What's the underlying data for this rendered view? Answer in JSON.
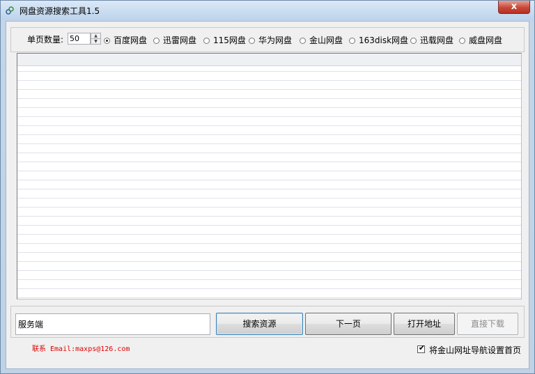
{
  "window": {
    "title": "网盘资源搜索工具1.5",
    "close_glyph": "x"
  },
  "options": {
    "page_count_label": "单页数量:",
    "page_count_value": "50",
    "providers": [
      {
        "label": "百度网盘",
        "selected": true
      },
      {
        "label": "迅雷网盘",
        "selected": false
      },
      {
        "label": "115网盘",
        "selected": false
      },
      {
        "label": "华为网盘",
        "selected": false
      },
      {
        "label": "金山网盘",
        "selected": false
      },
      {
        "label": "163disk网盘",
        "selected": false
      },
      {
        "label": "迅载网盘",
        "selected": false
      },
      {
        "label": "威盘网盘",
        "selected": false
      }
    ]
  },
  "bottom": {
    "server_input_value": "服务端",
    "search_button": "搜索资源",
    "next_page_button": "下一页",
    "open_address_button": "打开地址",
    "direct_download_button": "直接下载",
    "contact": "联系 Email:maxps@126.com",
    "homepage_checkbox_label": "将金山网址导航设置首页",
    "homepage_checked": true
  },
  "colors": {
    "contact_text": "#e00000",
    "close_button": "#c8483a",
    "title_bar": "#bcd3ec"
  }
}
